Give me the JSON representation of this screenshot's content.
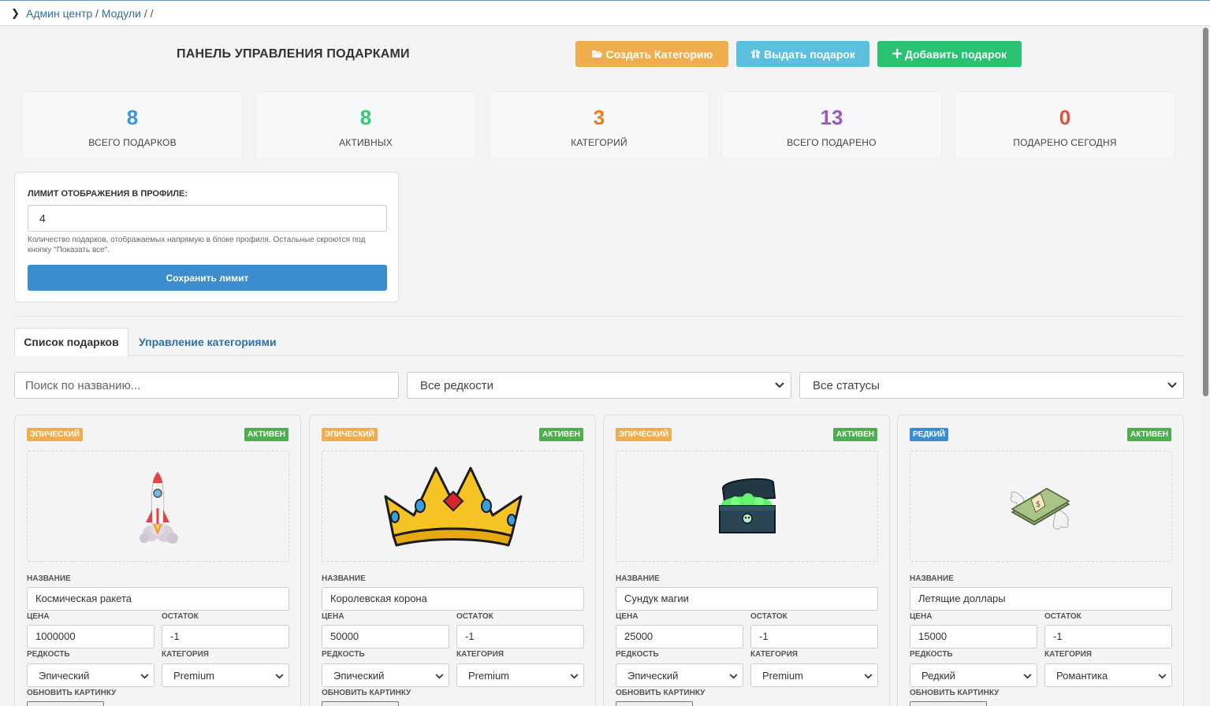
{
  "breadcrumb": {
    "items": [
      "Админ центр",
      "Модули"
    ],
    "sep": "/"
  },
  "header": {
    "title": "ПАНЕЛЬ УПРАВЛЕНИЯ ПОДАРКАМИ",
    "buttons": {
      "create_category": "Создать Категорию",
      "give_gift": "Выдать подарок",
      "add_gift": "Добавить подарок"
    }
  },
  "stats": [
    {
      "value": "8",
      "label": "ВСЕГО ПОДАРКОВ",
      "color": "#3498db"
    },
    {
      "value": "8",
      "label": "АКТИВНЫХ",
      "color": "#2ecc71"
    },
    {
      "value": "3",
      "label": "КАТЕГОРИЙ",
      "color": "#e67e22"
    },
    {
      "value": "13",
      "label": "ВСЕГО ПОДАРЕНО",
      "color": "#9b59b6"
    },
    {
      "value": "0",
      "label": "ПОДАРЕНО СЕГОДНЯ",
      "color": "#e74c3c"
    }
  ],
  "limit": {
    "label": "ЛИМИТ ОТОБРАЖЕНИЯ В ПРОФИЛЕ:",
    "value": "4",
    "help": "Количество подарков, отображаемых напрямую в блоке профиля. Остальные скроются под кнопку \"Показать все\".",
    "save_label": "Сохранить лимит"
  },
  "tabs": {
    "list": "Список подарков",
    "categories": "Управление категориями"
  },
  "filters": {
    "search_placeholder": "Поиск по названию...",
    "rarity": "Все редкости",
    "status": "Все статусы"
  },
  "field_labels": {
    "name": "НАЗВАНИЕ",
    "price": "ЦЕНА",
    "stock": "ОСТАТОК",
    "rarity": "РЕДКОСТЬ",
    "category": "КАТЕГОРИЯ",
    "update_image": "ОБНОВИТЬ КАРТИНКУ"
  },
  "gifts": [
    {
      "rarity_badge": "ЭПИЧЕСКИЙ",
      "status_badge": "АКТИВЕН",
      "name": "Космическая ракета",
      "price": "1000000",
      "stock": "-1",
      "rarity": "Эпический",
      "category": "Premium",
      "image": "rocket-image"
    },
    {
      "rarity_badge": "ЭПИЧЕСКИЙ",
      "status_badge": "АКТИВЕН",
      "name": "Королевская корона",
      "price": "50000",
      "stock": "-1",
      "rarity": "Эпический",
      "category": "Premium",
      "image": "crown-image"
    },
    {
      "rarity_badge": "ЭПИЧЕСКИЙ",
      "status_badge": "АКТИВЕН",
      "name": "Сундук магии",
      "price": "25000",
      "stock": "-1",
      "rarity": "Эпический",
      "category": "Premium",
      "image": "chest-image"
    },
    {
      "rarity_badge": "РЕДКИЙ",
      "status_badge": "АКТИВЕН",
      "name": "Летящие доллары",
      "price": "15000",
      "stock": "-1",
      "rarity": "Редкий",
      "category": "Романтика",
      "image": "flying-dollars-image"
    }
  ]
}
